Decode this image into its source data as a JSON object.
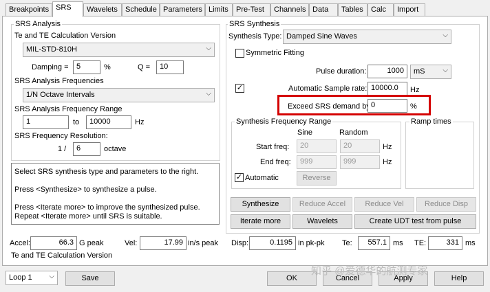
{
  "tabs": [
    "Breakpoints",
    "SRS",
    "Wavelets",
    "Schedule",
    "Parameters",
    "Limits",
    "Pre-Test",
    "Channels",
    "Data",
    "Tables",
    "Calc",
    "Import"
  ],
  "srs_analysis": {
    "title": "SRS Analysis",
    "calc_version_label": "Te and TE Calculation Version",
    "calc_version_value": "MIL-STD-810H",
    "damping_label": "Damping =",
    "damping_value": "5",
    "damping_unit": "%",
    "q_label": "Q =",
    "q_value": "10",
    "freq_label": "SRS Analysis Frequencies",
    "freq_value": "1/N Octave Intervals",
    "range_label": "SRS Analysis Frequency Range",
    "range_from": "1",
    "range_to_label": "to",
    "range_to": "10000",
    "range_unit": "Hz",
    "resolution_label": "SRS Frequency Resolution:",
    "resolution_prefix": "1 /",
    "resolution_value": "6",
    "resolution_unit": "octave"
  },
  "info_text": "Select SRS synthesis type and parameters to the right.\n\nPress <Synthesize> to synthesize a pulse.\n\nPress <Iterate more> to improve the synthesized pulse.\nRepeat <Iterate more> until SRS is suitable.",
  "srs_synthesis": {
    "title": "SRS Synthesis",
    "type_label": "Synthesis Type:",
    "type_value": "Damped Sine Waves",
    "symmetric_label": "Symmetric Fitting",
    "symmetric_checked": false,
    "pulse_duration_label": "Pulse duration:",
    "pulse_duration_value": "1000",
    "pulse_duration_unit": "mS",
    "auto_sample_checked": true,
    "auto_sample_label": "Automatic Sample rate:",
    "auto_sample_value": "10000.0",
    "auto_sample_unit": "Hz",
    "exceed_label": "Exceed SRS demand by",
    "exceed_value": "0",
    "exceed_unit": "%"
  },
  "synthesis_range": {
    "title": "Synthesis Frequency Range",
    "sine_header": "Sine",
    "random_header": "Random",
    "start_label": "Start freq:",
    "start_sine": "20",
    "start_random": "20",
    "start_unit": "Hz",
    "end_label": "End freq:",
    "end_sine": "999",
    "end_random": "999",
    "end_unit": "Hz",
    "automatic_label": "Automatic",
    "automatic_checked": true,
    "reverse_label": "Reverse"
  },
  "ramp_times_title": "Ramp times",
  "actions": {
    "synthesize": "Synthesize",
    "reduce_accel": "Reduce Accel",
    "reduce_vel": "Reduce Vel",
    "reduce_disp": "Reduce Disp",
    "iterate_more": "Iterate more",
    "wavelets": "Wavelets",
    "create_udt": "Create UDT test from pulse"
  },
  "readouts": {
    "accel_label": "Accel:",
    "accel_value": "66.3",
    "accel_unit": "G peak",
    "vel_label": "Vel:",
    "vel_value": "17.99",
    "vel_unit": "in/s peak",
    "disp_label": "Disp:",
    "disp_value": "0.1195",
    "disp_unit": "in pk-pk",
    "te_label": "Te:",
    "te_value": "557.1",
    "te_unit": "ms",
    "tE_label": "TE:",
    "tE_value": "331",
    "tE_unit": "ms",
    "version_text": "Te and TE Calculation Version"
  },
  "footer": {
    "loop_value": "Loop 1",
    "save": "Save",
    "ok": "OK",
    "cancel": "Cancel",
    "apply": "Apply",
    "help": "Help"
  },
  "watermark": "知乎 @爱德华的航测专家",
  "colors": {
    "highlight": "#d40000",
    "panel_bg": "#ffffff",
    "window_bg": "#f0f0f0"
  }
}
